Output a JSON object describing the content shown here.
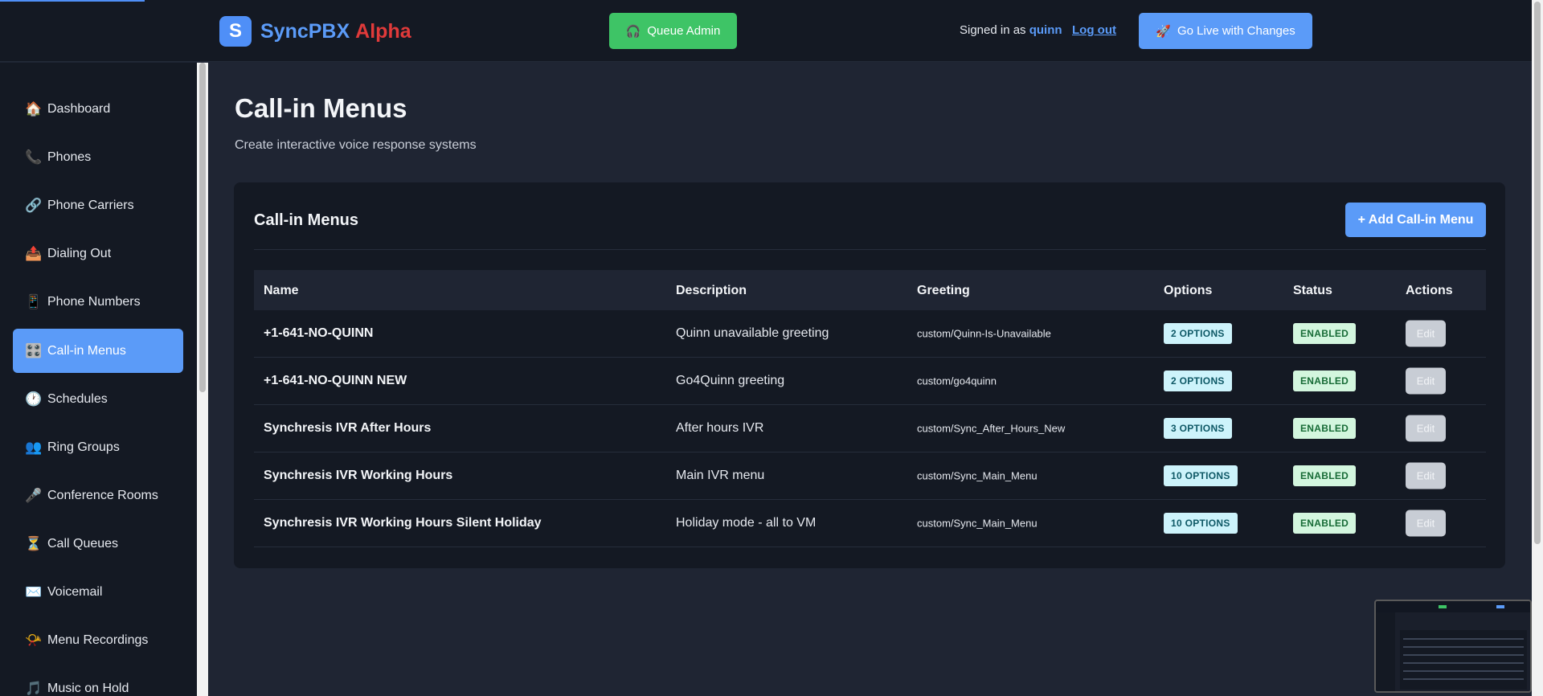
{
  "header": {
    "logo_letter": "S",
    "app_name": "SyncPBX",
    "app_tag": "Alpha",
    "queue_admin_label": "Queue Admin",
    "signed_in_prefix": "Signed in as",
    "username": "quinn",
    "logout_label": "Log out",
    "go_live_label": "Go Live with Changes"
  },
  "sidebar": {
    "items": [
      {
        "icon": "🏠",
        "label": "Dashboard",
        "active": false
      },
      {
        "icon": "📞",
        "label": "Phones",
        "active": false
      },
      {
        "icon": "🔗",
        "label": "Phone Carriers",
        "active": false
      },
      {
        "icon": "📤",
        "label": "Dialing Out",
        "active": false
      },
      {
        "icon": "📱",
        "label": "Phone Numbers",
        "active": false
      },
      {
        "icon": "🎛️",
        "label": "Call-in Menus",
        "active": true
      },
      {
        "icon": "🕐",
        "label": "Schedules",
        "active": false
      },
      {
        "icon": "👥",
        "label": "Ring Groups",
        "active": false
      },
      {
        "icon": "🎤",
        "label": "Conference Rooms",
        "active": false
      },
      {
        "icon": "⏳",
        "label": "Call Queues",
        "active": false
      },
      {
        "icon": "✉️",
        "label": "Voicemail",
        "active": false
      },
      {
        "icon": "📯",
        "label": "Menu Recordings",
        "active": false
      },
      {
        "icon": "🎵",
        "label": "Music on Hold",
        "active": false
      }
    ]
  },
  "page": {
    "title": "Call-in Menus",
    "subtitle": "Create interactive voice response systems"
  },
  "card": {
    "title": "Call-in Menus",
    "add_label": "+ Add Call-in Menu",
    "columns": [
      "Name",
      "Description",
      "Greeting",
      "Options",
      "Status",
      "Actions"
    ],
    "rows": [
      {
        "name": "+1-641-NO-QUINN",
        "description": "Quinn unavailable greeting",
        "greeting": "custom/Quinn-Is-Unavailable",
        "options": "2 OPTIONS",
        "status": "ENABLED",
        "action": "Edit"
      },
      {
        "name": "+1-641-NO-QUINN NEW",
        "description": "Go4Quinn greeting",
        "greeting": "custom/go4quinn",
        "options": "2 OPTIONS",
        "status": "ENABLED",
        "action": "Edit"
      },
      {
        "name": "Synchresis IVR After Hours",
        "description": "After hours IVR",
        "greeting": "custom/Sync_After_Hours_New",
        "options": "3 OPTIONS",
        "status": "ENABLED",
        "action": "Edit"
      },
      {
        "name": "Synchresis IVR Working Hours",
        "description": "Main IVR menu",
        "greeting": "custom/Sync_Main_Menu",
        "options": "10 OPTIONS",
        "status": "ENABLED",
        "action": "Edit"
      },
      {
        "name": "Synchresis IVR Working Hours Silent Holiday",
        "description": "Holiday mode - all to VM",
        "greeting": "custom/Sync_Main_Menu",
        "options": "10 OPTIONS",
        "status": "ENABLED",
        "action": "Edit"
      }
    ]
  },
  "colors": {
    "accent": "#5b9bf8",
    "success": "#3ec466",
    "brand_alpha": "#e03a3a",
    "background": "#1f2533",
    "panel": "#141923"
  }
}
